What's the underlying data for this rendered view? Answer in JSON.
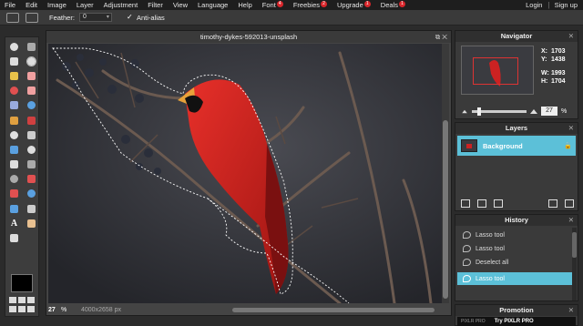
{
  "menu": {
    "items": [
      {
        "label": "File"
      },
      {
        "label": "Edit"
      },
      {
        "label": "Image"
      },
      {
        "label": "Layer"
      },
      {
        "label": "Adjustment"
      },
      {
        "label": "Filter"
      },
      {
        "label": "View"
      },
      {
        "label": "Language"
      },
      {
        "label": "Help"
      },
      {
        "label": "Font",
        "badge": "4"
      },
      {
        "label": "Freebies",
        "badge": "2"
      },
      {
        "label": "Upgrade",
        "badge": "1"
      },
      {
        "label": "Deals",
        "badge": "1"
      }
    ],
    "login": "Login",
    "separator": "|",
    "signup": "Sign up"
  },
  "options": {
    "feather_label": "Feather:",
    "feather_value": "0",
    "antialias_label": "Anti-alias",
    "antialias_checked": true
  },
  "document": {
    "title": "timothy-dykes-592013-unsplash",
    "zoom": "27",
    "zoom_unit": "%",
    "dimensions": "4000x2658 px"
  },
  "navigator": {
    "title": "Navigator",
    "x_label": "X:",
    "x": "1703",
    "y_label": "Y:",
    "y": "1438",
    "w_label": "W:",
    "w": "1993",
    "h_label": "H:",
    "h": "1704",
    "zoom": "27",
    "zoom_unit": "%"
  },
  "layers": {
    "title": "Layers",
    "items": [
      {
        "name": "Background",
        "locked": true
      }
    ]
  },
  "history": {
    "title": "History",
    "items": [
      {
        "label": "Lasso tool"
      },
      {
        "label": "Lasso tool"
      },
      {
        "label": "Deselect all"
      },
      {
        "label": "Lasso tool",
        "active": true
      }
    ]
  },
  "promotion": {
    "title": "Promotion",
    "tag": "PIXLR PRO",
    "text": "Try PIXLR PRO"
  },
  "colors": {
    "accent": "#5cc0d8",
    "badge": "#d9262b",
    "cardinal": "#d32222"
  },
  "tools": [
    "crop-icon",
    "move-icon",
    "marquee-icon",
    "lasso-icon",
    "wand-icon",
    "pencil-icon",
    "brush-icon",
    "eraser-icon",
    "bucket-icon",
    "gradient-icon",
    "clone-icon",
    "color-replace-icon",
    "drawing-icon",
    "blur-icon",
    "sharpen-icon",
    "smudge-icon",
    "sponge-icon",
    "dodge-icon",
    "burn-icon",
    "red-eye-icon",
    "spot-heal-icon",
    "bloat-icon",
    "pinch-icon",
    "colorpicker-icon",
    "type-icon",
    "hand-icon",
    "zoom-icon"
  ]
}
